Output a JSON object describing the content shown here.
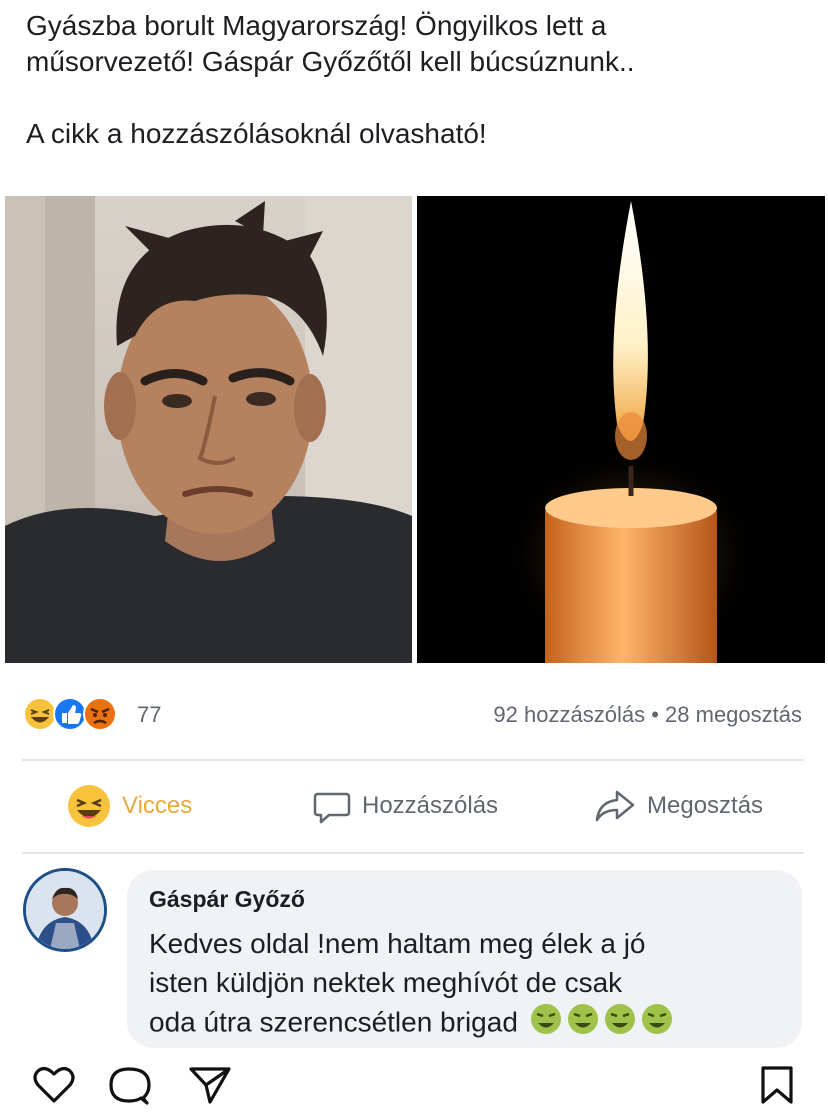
{
  "post": {
    "line1": "Gyászba borult Magyarország! Öngyilkos lett a",
    "line2": "műsorvezető! Gáspár Győzőtől kell búcsúznunk..",
    "line3": "A cikk a hozzászólásoknál olvasható!"
  },
  "reactions": {
    "icons": [
      "laughing-face",
      "thumbs-up",
      "angry-face"
    ],
    "count": "77"
  },
  "stats": {
    "comments": "92 hozzászólás",
    "separator": "•",
    "shares": "28 megosztás"
  },
  "actions": {
    "like_label": "Vicces",
    "comment_label": "Hozzászólás",
    "share_label": "Megosztás"
  },
  "comment": {
    "author": "Gáspár Győző",
    "line1": "Kedves oldal !nem haltam meg élek a jó",
    "line2": "isten küldjön nektek meghívót de csak",
    "line3": "oda útra szerencsétlen brigad",
    "emoji": "nauseated-face"
  },
  "bottom_bar": {
    "icons": [
      "heart-icon",
      "comment-icon",
      "send-icon",
      "bookmark-icon"
    ]
  },
  "colors": {
    "accent_laugh": "#e8a93a",
    "like_blue": "#1877f2",
    "angry_orange": "#e9710f",
    "meta_text": "#606770",
    "bubble_bg": "#f0f2f5",
    "avatar_ring": "#1b4f86"
  }
}
